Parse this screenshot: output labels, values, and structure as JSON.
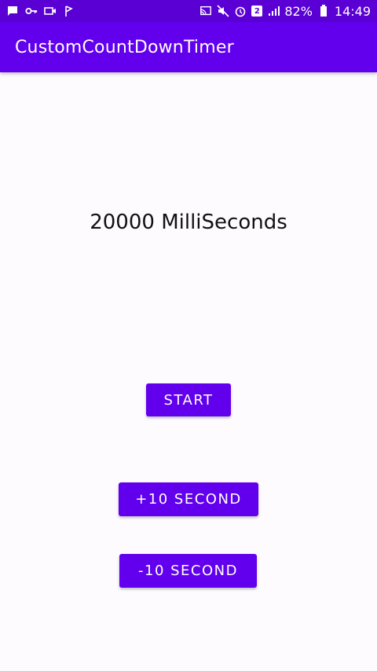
{
  "status_bar": {
    "battery": "82%",
    "time": "14:49",
    "notification_badge": "2",
    "icons_left": [
      "message-icon",
      "key-icon",
      "video-icon",
      "flag-icon"
    ],
    "icons_right": [
      "cast-icon",
      "mute-icon",
      "alarm-icon",
      "badge-icon",
      "signal-icon",
      "battery-icon"
    ]
  },
  "app_bar": {
    "title": "CustomCountDownTimer"
  },
  "main": {
    "timer_text": "20000 MilliSeconds",
    "start_label": "START",
    "plus_label": "+10 SECOND",
    "minus_label": "-10 SECOND"
  },
  "colors": {
    "primary": "#6200ee",
    "primary_dark": "#5a00d4",
    "background": "#fdfbfe"
  }
}
